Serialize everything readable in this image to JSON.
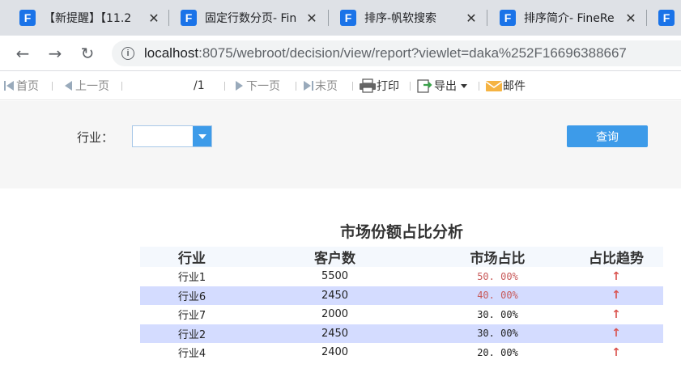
{
  "tabs": [
    {
      "title": "【新提醒】【11.2",
      "close": "✕"
    },
    {
      "title": "固定行数分页- Fin",
      "close": "✕"
    },
    {
      "title": "排序-帆软搜索",
      "close": "✕"
    },
    {
      "title": "排序简介- FineRe",
      "close": "✕"
    }
  ],
  "favicon_glyph": "F",
  "nav": {
    "back": "←",
    "forward": "→",
    "reload": "↻",
    "info": "i"
  },
  "url": {
    "host": "localhost",
    "path": ":8075/webroot/decision/view/report?viewlet=daka%252F16696388667"
  },
  "toolbar": {
    "first": "首页",
    "prev": "上一页",
    "page_value": "1",
    "page_total": "/1",
    "next": "下一页",
    "last": "末页",
    "print": "打印",
    "export": "导出",
    "mail": "邮件"
  },
  "filter": {
    "label": "行业：",
    "query_button": "查询"
  },
  "report": {
    "title": "市场份额占比分析",
    "headers": [
      "行业",
      "客户数",
      "市场占比",
      "占比趋势"
    ],
    "rows": [
      {
        "industry": "行业1",
        "customers": "5500",
        "share": "50. 00%",
        "trend": "↑"
      },
      {
        "industry": "行业6",
        "customers": "2450",
        "share": "40. 00%",
        "trend": "↑"
      },
      {
        "industry": "行业7",
        "customers": "2000",
        "share": "30. 00%",
        "trend": "↑"
      },
      {
        "industry": "行业2",
        "customers": "2450",
        "share": "30. 00%",
        "trend": "↑"
      },
      {
        "industry": "行业4",
        "customers": "2400",
        "share": "20. 00%",
        "trend": "↑"
      }
    ]
  },
  "colors": {
    "accent": "#3d9be9",
    "alt_row": "#d4dcff",
    "highlight": "#c85a5a",
    "trend": "#d9534f"
  }
}
